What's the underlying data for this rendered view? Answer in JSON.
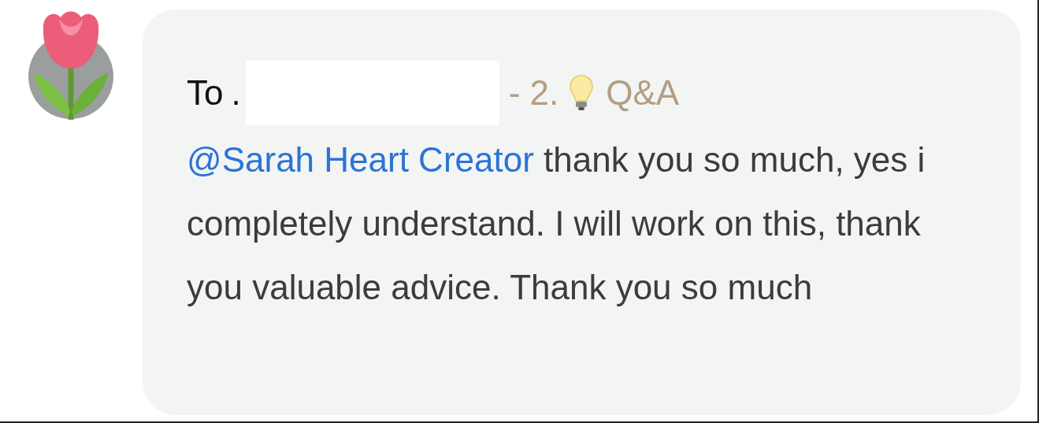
{
  "comment": {
    "to_label": "To",
    "recipient": ".",
    "number": "- 2.",
    "tag": "Q&A",
    "mention": "@Sarah Heart Creator",
    "text": " thank you so much, yes i completely understand. I will work on this, thank you valuable advice. Thank you so much"
  }
}
